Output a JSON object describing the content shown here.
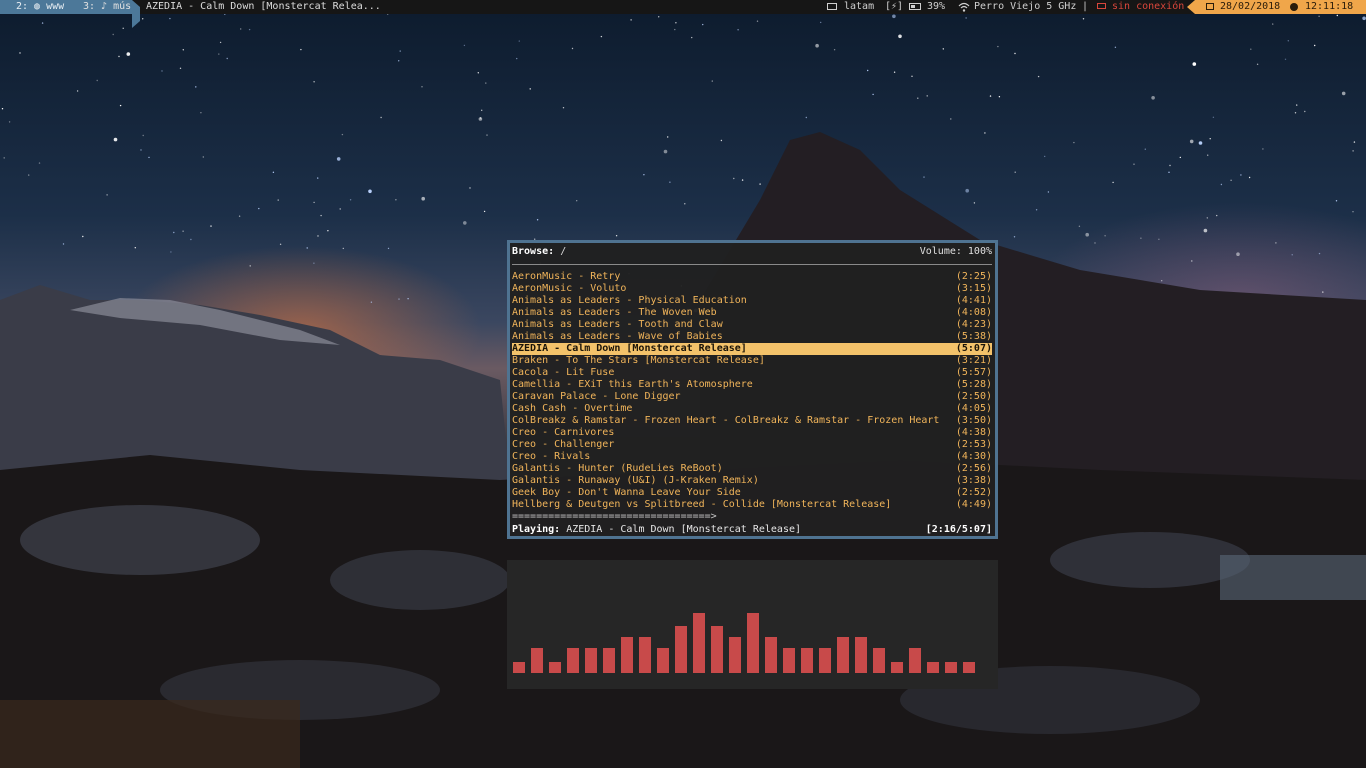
{
  "topbar": {
    "workspace_active": {
      "number": "2:",
      "label": "www"
    },
    "workspace_inactive": {
      "number": "3:",
      "label": "♪ mús"
    },
    "window_title": "AZEDIA - Calm Down [Monstercat Relea...",
    "keyboard_layout": "latam",
    "battery_state": "[⚡]",
    "battery_percent": "39%",
    "wifi_name": "Perro Viejo 5 GHz",
    "separator": "|",
    "network_status": "sin conexión",
    "date": "28/02/2018",
    "time": "12:11:18",
    "colors": {
      "active_ws": "#4c7899",
      "date_bg": "#f0a64a",
      "offline": "#d9463b"
    }
  },
  "player": {
    "browse_label": "Browse:",
    "browse_path": "/",
    "volume": "Volume: 100%",
    "tracks": [
      {
        "title": "AeronMusic - Retry",
        "duration": "(2:25)"
      },
      {
        "title": "AeronMusic - Voluto",
        "duration": "(3:15)"
      },
      {
        "title": "Animals as Leaders - Physical Education",
        "duration": "(4:41)"
      },
      {
        "title": "Animals as Leaders - The Woven Web",
        "duration": "(4:08)"
      },
      {
        "title": "Animals as Leaders - Tooth and Claw",
        "duration": "(4:23)"
      },
      {
        "title": "Animals as Leaders - Wave of Babies",
        "duration": "(5:38)"
      },
      {
        "title": "AZEDIA - Calm Down [Monstercat Release]",
        "duration": "(5:07)",
        "selected": true
      },
      {
        "title": "Braken - To The Stars [Monstercat Release]",
        "duration": "(3:21)"
      },
      {
        "title": "Cacola - Lit Fuse",
        "duration": "(5:57)"
      },
      {
        "title": "Camellia - EXiT this Earth's Atomosphere",
        "duration": "(5:28)"
      },
      {
        "title": "Caravan Palace - Lone Digger",
        "duration": "(2:50)"
      },
      {
        "title": "Cash Cash - Overtime",
        "duration": "(4:05)"
      },
      {
        "title": "ColBreakz & Ramstar - Frozen Heart - ColBreakz & Ramstar - Frozen Heart",
        "duration": "(3:50)"
      },
      {
        "title": "Creo - Carnivores",
        "duration": "(4:38)"
      },
      {
        "title": "Creo - Challenger",
        "duration": "(2:53)"
      },
      {
        "title": "Creo - Rivals",
        "duration": "(4:30)"
      },
      {
        "title": "Galantis - Hunter (RudeLies ReBoot)",
        "duration": "(2:56)"
      },
      {
        "title": "Galantis - Runaway (U&I) (J-Kraken Remix)",
        "duration": "(3:38)"
      },
      {
        "title": "Geek Boy - Don't Wanna Leave Your Side",
        "duration": "(2:52)"
      },
      {
        "title": "Hellberg & Deutgen vs Splitbreed - Collide [Monstercat Release]",
        "duration": "(4:49)"
      }
    ],
    "progress_bar": "=================================>",
    "playing_label": "Playing:",
    "now_playing": "AZEDIA - Calm Down [Monstercat Release]",
    "elapsed": "[2:16/5:07]",
    "colors": {
      "track": "#f0b45a",
      "selected_bg": "#f3c26a",
      "border": "#4f7391"
    }
  },
  "visualizer": {
    "levels": [
      0.19,
      0.41,
      0.19,
      0.41,
      0.41,
      0.41,
      0.6,
      0.6,
      0.41,
      0.79,
      1.0,
      0.79,
      0.6,
      1.0,
      0.6,
      0.41,
      0.41,
      0.41,
      0.6,
      0.6,
      0.41,
      0.19,
      0.41,
      0.19,
      0.19,
      0.19
    ],
    "color": "#c84a4a"
  }
}
